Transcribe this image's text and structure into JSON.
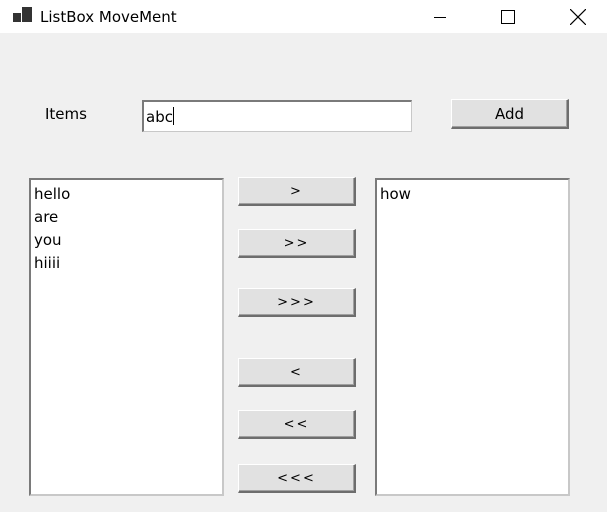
{
  "window": {
    "title": "ListBox MoveMent",
    "controls": [
      "minimize-icon",
      "maximize-icon",
      "close-icon"
    ]
  },
  "form": {
    "items_label": "Items",
    "input_value": "abc",
    "add_label": "Add"
  },
  "left_list": {
    "items": [
      "hello",
      "are",
      "you",
      "hiiii"
    ]
  },
  "right_list": {
    "items": [
      "how"
    ]
  },
  "move_buttons": {
    "move_selected_right": ">",
    "move_all_right": ">>",
    "move_all_right_alt": ">>>",
    "move_selected_left": "<",
    "move_all_left": "<<",
    "move_all_left_alt": "<<<"
  }
}
